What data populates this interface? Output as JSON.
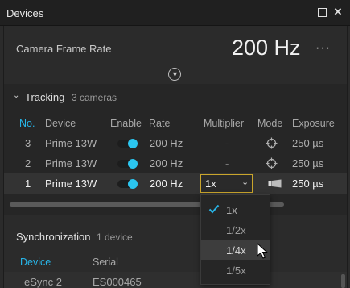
{
  "window": {
    "title": "Devices",
    "maximize_icon": "maximize-icon",
    "close_label": "✕"
  },
  "frame_rate": {
    "label": "Camera Frame Rate",
    "value": "200 Hz",
    "more_label": "···",
    "collapse_icon": "chevron-down-circle-icon"
  },
  "tracking": {
    "title": "Tracking",
    "count": "3 cameras",
    "columns": [
      "No.",
      "Device",
      "Enable",
      "Rate",
      "Multiplier",
      "Mode",
      "Exposure"
    ],
    "rows": [
      {
        "no": "3",
        "device": "Prime 13W",
        "enabled": true,
        "rate": "200 Hz",
        "multiplier": "-",
        "mode_icon": "crosshair-icon",
        "exposure": "250 µs"
      },
      {
        "no": "2",
        "device": "Prime 13W",
        "enabled": true,
        "rate": "200 Hz",
        "multiplier": "-",
        "mode_icon": "crosshair-icon",
        "exposure": "250 µs"
      },
      {
        "no": "1",
        "device": "Prime 13W",
        "enabled": true,
        "rate": "200 Hz",
        "multiplier": "1x",
        "mode_icon": "video-mode-icon",
        "exposure": "250 µs"
      }
    ],
    "multiplier_dropdown": {
      "selected": "1x",
      "options": [
        "1x",
        "1/2x",
        "1/4x",
        "1/5x"
      ],
      "checked": "1x",
      "hovered": "1/4x"
    }
  },
  "synchronization": {
    "title": "Synchronization",
    "count": "1 device",
    "columns": [
      "Device",
      "Serial"
    ],
    "rows": [
      {
        "device": "eSync 2",
        "serial": "ES000465"
      }
    ]
  },
  "colors": {
    "accent": "#27b5e8",
    "focus_border": "#c9a52c",
    "background": "#2b2b2b"
  }
}
